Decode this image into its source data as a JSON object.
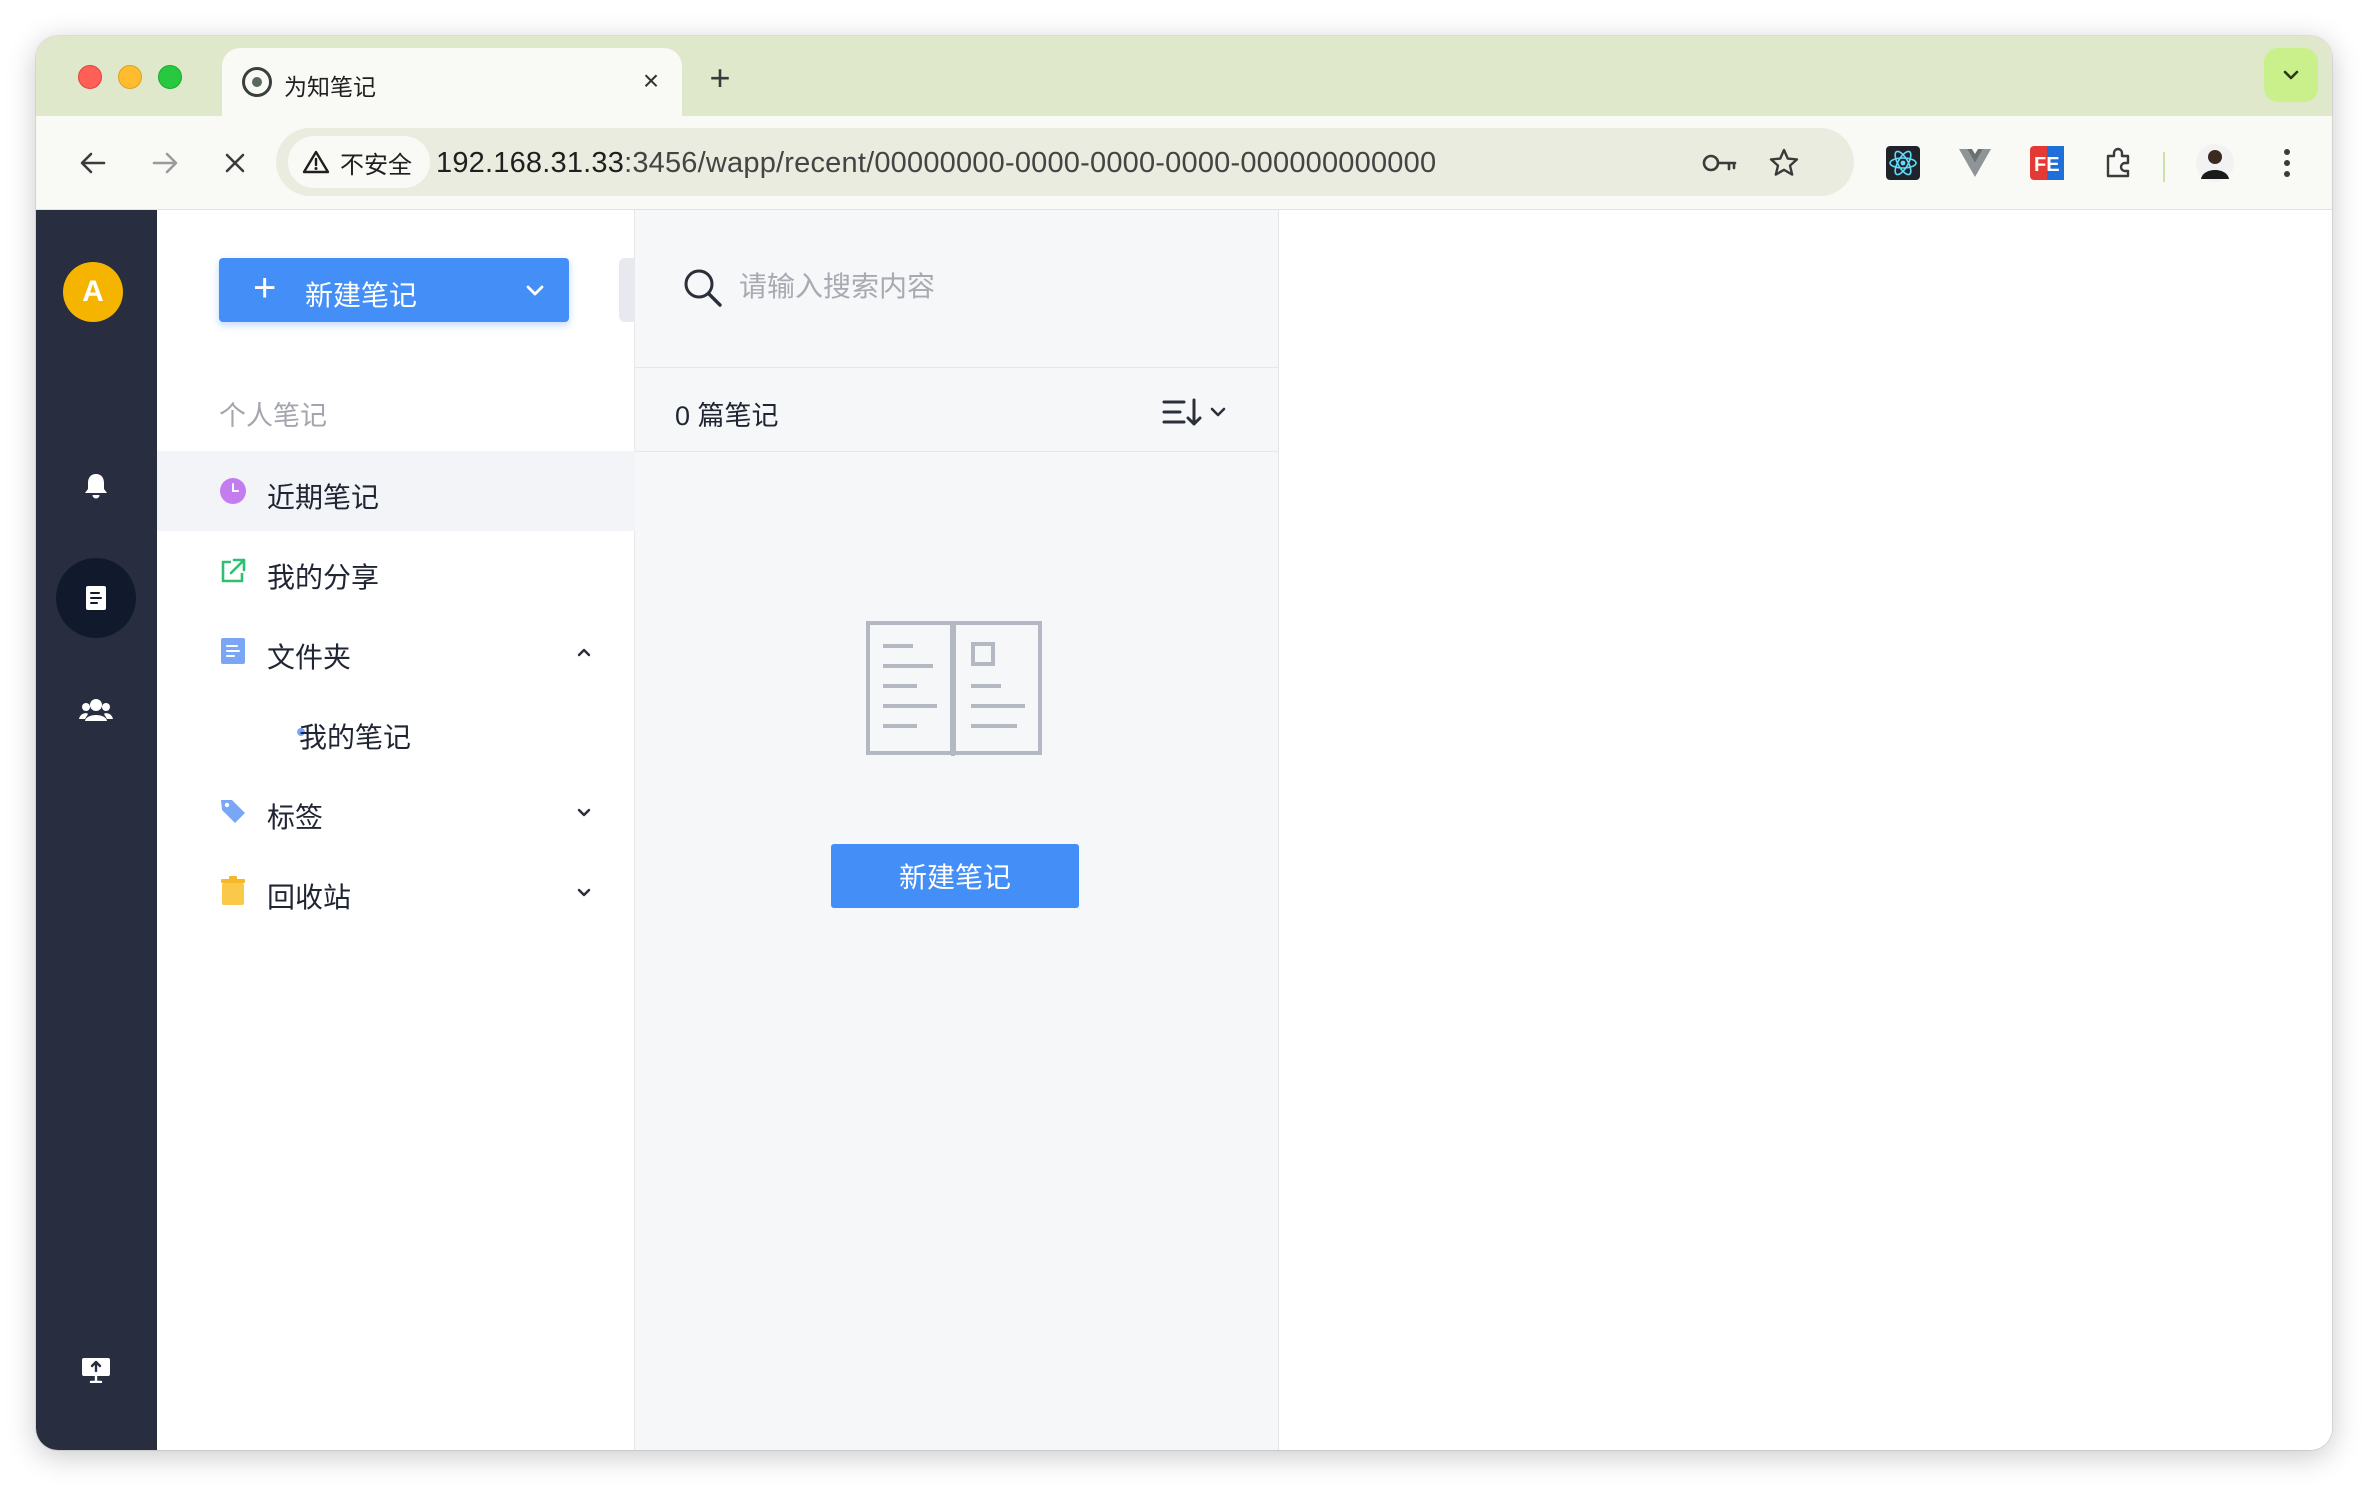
{
  "browser": {
    "tab": {
      "title": "为知笔记",
      "favicon": "wiz-logo-icon"
    },
    "address": {
      "security_label": "不安全",
      "url_host": "192.168.31.33",
      "url_rest": ":3456/wapp/recent/00000000-0000-0000-0000-000000000000"
    }
  },
  "rail": {
    "avatar_letter": "A",
    "items": [
      "bell-icon",
      "note-icon",
      "group-icon",
      "screen-icon"
    ]
  },
  "sidebar": {
    "new_note_label": "新建笔记",
    "section_title": "个人笔记",
    "items": [
      {
        "label": "近期笔记",
        "icon": "clock-icon"
      },
      {
        "label": "我的分享",
        "icon": "share-icon"
      },
      {
        "label": "文件夹",
        "icon": "folder-doc-icon"
      },
      {
        "label": "我的笔记",
        "icon": "dot"
      },
      {
        "label": "标签",
        "icon": "tag-icon"
      },
      {
        "label": "回收站",
        "icon": "trash-icon"
      }
    ]
  },
  "list": {
    "search_placeholder": "请输入搜索内容",
    "count_text": "0 篇笔记",
    "empty_button_label": "新建笔记"
  },
  "colors": {
    "primary": "#448ef7",
    "rail_bg": "#282d40",
    "avatar": "#f4b400",
    "tab_strip": "#dfe8cb"
  }
}
